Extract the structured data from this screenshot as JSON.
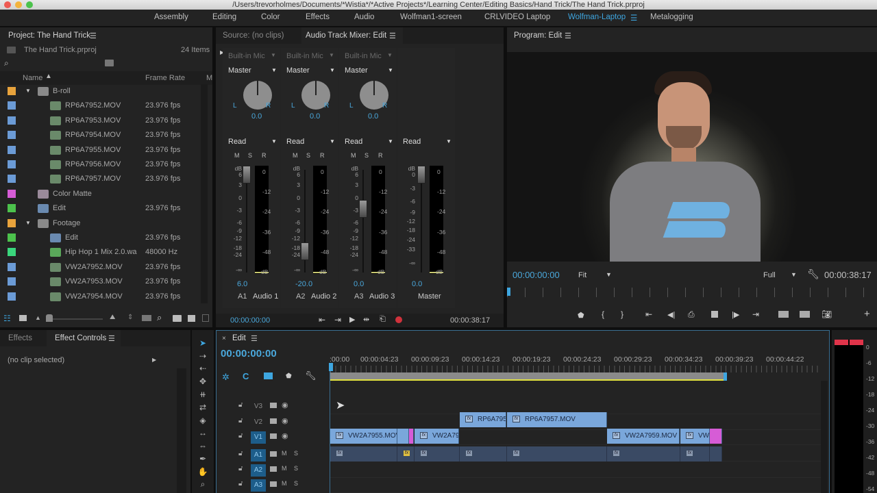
{
  "window": {
    "title": "/Users/trevorholmes/Documents/*Wistia*/*Active Projects*/Learning Center/Editing Basics/Hand Trick/The Hand Trick.prproj"
  },
  "workspaces": [
    {
      "label": "Assembly",
      "active": false
    },
    {
      "label": "Editing",
      "active": false
    },
    {
      "label": "Color",
      "active": false
    },
    {
      "label": "Effects",
      "active": false
    },
    {
      "label": "Audio",
      "active": false
    },
    {
      "label": "Wolfman1-screen",
      "active": false
    },
    {
      "label": "CRLVIDEO Laptop",
      "active": false
    },
    {
      "label": "Wolfman-Laptop",
      "active": true
    },
    {
      "label": "Metalogging",
      "active": false
    }
  ],
  "project": {
    "title": "Project: The Hand Trick",
    "file": "The Hand Trick.prproj",
    "item_count": "24 Items",
    "col_name": "Name",
    "col_framerate": "Frame Rate",
    "col_more": "M",
    "items": [
      {
        "name": "B-roll",
        "rate": "",
        "color": "#e8a33c",
        "type": "folder",
        "indent": 1,
        "expanded": true
      },
      {
        "name": "RP6A7952.MOV",
        "rate": "23.976 fps",
        "color": "#6b9bd6",
        "type": "clip",
        "indent": 2
      },
      {
        "name": "RP6A7953.MOV",
        "rate": "23.976 fps",
        "color": "#6b9bd6",
        "type": "clip",
        "indent": 2
      },
      {
        "name": "RP6A7954.MOV",
        "rate": "23.976 fps",
        "color": "#6b9bd6",
        "type": "clip",
        "indent": 2
      },
      {
        "name": "RP6A7955.MOV",
        "rate": "23.976 fps",
        "color": "#6b9bd6",
        "type": "clip",
        "indent": 2
      },
      {
        "name": "RP6A7956.MOV",
        "rate": "23.976 fps",
        "color": "#6b9bd6",
        "type": "clip",
        "indent": 2
      },
      {
        "name": "RP6A7957.MOV",
        "rate": "23.976 fps",
        "color": "#6b9bd6",
        "type": "clip",
        "indent": 2
      },
      {
        "name": "Color Matte",
        "rate": "",
        "color": "#d65cd6",
        "type": "matte",
        "indent": 1
      },
      {
        "name": "Edit",
        "rate": "23.976 fps",
        "color": "#4cc24c",
        "type": "sequence",
        "indent": 1
      },
      {
        "name": "Footage",
        "rate": "",
        "color": "#e8a33c",
        "type": "folder",
        "indent": 1,
        "expanded": true
      },
      {
        "name": "Edit",
        "rate": "23.976 fps",
        "color": "#4cc24c",
        "type": "sequence",
        "indent": 2
      },
      {
        "name": "Hip Hop 1 Mix 2.0.wa",
        "rate": "48000 Hz",
        "color": "#3ad67c",
        "type": "audio",
        "indent": 2
      },
      {
        "name": "VW2A7952.MOV",
        "rate": "23.976 fps",
        "color": "#6b9bd6",
        "type": "clip",
        "indent": 2
      },
      {
        "name": "VW2A7953.MOV",
        "rate": "23.976 fps",
        "color": "#6b9bd6",
        "type": "clip",
        "indent": 2
      },
      {
        "name": "VW2A7954.MOV",
        "rate": "23.976 fps",
        "color": "#6b9bd6",
        "type": "clip",
        "indent": 2
      }
    ]
  },
  "source_tab": "Source: (no clips)",
  "mixer": {
    "title": "Audio Track Mixer: Edit",
    "channels": [
      {
        "input": "Built-in Mic",
        "output": "Master",
        "pan": "0.0",
        "mode": "Read",
        "volume": "6.0",
        "track_id": "A1",
        "name": "Audio 1",
        "fader_db": 6
      },
      {
        "input": "Built-in Mic",
        "output": "Master",
        "pan": "0.0",
        "mode": "Read",
        "volume": "-20.0",
        "track_id": "A2",
        "name": "Audio 2",
        "fader_db": -20
      },
      {
        "input": "Built-in Mic",
        "output": "Master",
        "pan": "0.0",
        "mode": "Read",
        "volume": "0.0",
        "track_id": "A3",
        "name": "Audio 3",
        "fader_db": 0
      }
    ],
    "master": {
      "mode": "Read",
      "volume": "0.0",
      "name": "Master"
    },
    "msr": [
      "M",
      "S",
      "R"
    ],
    "pan_l": "L",
    "pan_r": "R",
    "fader_scale": [
      "dB",
      "6",
      "3",
      "0",
      "-3",
      "-6",
      "-9",
      "-12",
      "-18",
      "-24",
      "-∞"
    ],
    "master_scale": [
      "dB",
      "0",
      "-3",
      "-6",
      "-9",
      "-12",
      "-18",
      "-24",
      "-33",
      "-∞"
    ],
    "meter_scale": [
      "0",
      "-12",
      "-24",
      "-36",
      "-48",
      "dB"
    ],
    "timecode_in": "00:00:00:00",
    "timecode_out": "00:00:38:17"
  },
  "program": {
    "title": "Program: Edit",
    "timecode": "00:00:00:00",
    "fit": "Fit",
    "quality": "Full",
    "duration": "00:00:38:17"
  },
  "effects_tab": "Effects",
  "effect_controls": {
    "title": "Effect Controls",
    "empty": "(no clip selected)"
  },
  "timeline": {
    "title": "Edit",
    "timecode": "00:00:00:00",
    "ruler": [
      ":00:00",
      "00:00:04:23",
      "00:00:09:23",
      "00:00:14:23",
      "00:00:19:23",
      "00:00:24:23",
      "00:00:29:23",
      "00:00:34:23",
      "00:00:39:23",
      "00:00:44:22"
    ],
    "tracks": [
      {
        "id": "V3",
        "type": "video",
        "targeted": false
      },
      {
        "id": "V2",
        "type": "video",
        "targeted": false
      },
      {
        "id": "V1",
        "type": "video",
        "targeted": true
      },
      {
        "id": "A1",
        "type": "audio",
        "targeted": true
      },
      {
        "id": "A2",
        "type": "audio",
        "targeted": true
      },
      {
        "id": "A3",
        "type": "audio",
        "targeted": true
      }
    ],
    "clips_v2": [
      "RP6A795",
      "RP6A7957.MOV"
    ],
    "clips_v1": [
      "VW2A7955.MOV",
      "VW2A79",
      "VW2A7959.MOV",
      "VW2"
    ],
    "audio_m": "M",
    "audio_s": "S"
  },
  "master_meter_scale": [
    "0",
    "-6",
    "-12",
    "-18",
    "-24",
    "-30",
    "-36",
    "-42",
    "-48",
    "-54"
  ],
  "colors": {
    "accent": "#3ea6e0",
    "clip_video": "#7aa7db",
    "clip_audio": "#3a4a64",
    "matte": "#d65cd6",
    "record": "#d0323c",
    "peak": "#e0344a"
  }
}
